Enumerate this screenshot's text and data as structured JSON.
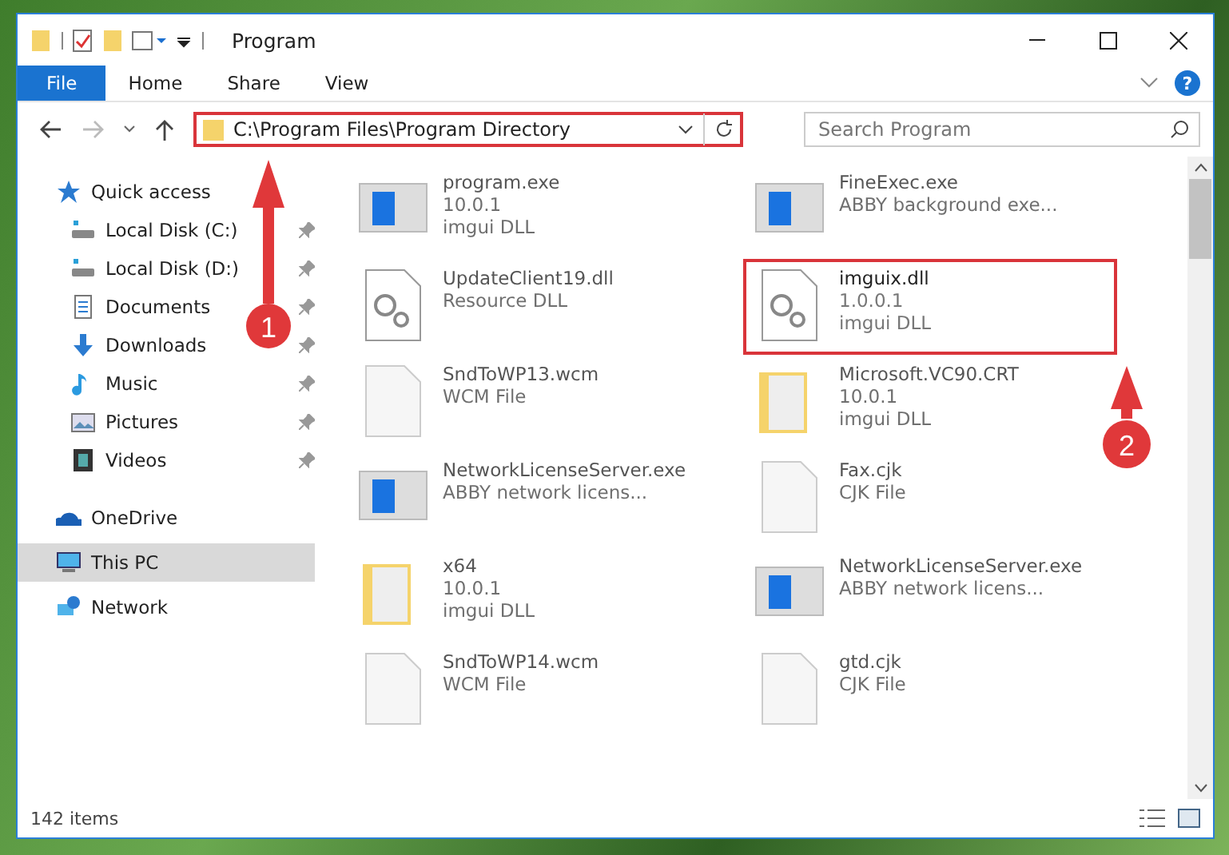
{
  "window": {
    "title": "Program"
  },
  "ribbon_tabs": [
    {
      "label": "File",
      "selected": true
    },
    {
      "label": "Home",
      "selected": false
    },
    {
      "label": "Share",
      "selected": false
    },
    {
      "label": "View",
      "selected": false
    }
  ],
  "help": "?",
  "address": {
    "path": "C:\\Program Files\\Program Directory"
  },
  "search": {
    "placeholder": "Search Program"
  },
  "sidebar": {
    "items": [
      {
        "label": "Quick access",
        "selected": false,
        "children": [
          {
            "label": "Local Disk (C:)",
            "pinned": true,
            "selected": false
          },
          {
            "label": "Local Disk (D:)",
            "pinned": true,
            "selected": false
          },
          {
            "label": "Documents",
            "pinned": true,
            "selected": false
          },
          {
            "label": "Downloads",
            "pinned": true,
            "selected": false
          },
          {
            "label": "Music",
            "pinned": true,
            "selected": false
          },
          {
            "label": "Pictures",
            "pinned": true,
            "selected": false
          },
          {
            "label": "Videos",
            "pinned": true,
            "selected": false
          }
        ]
      },
      {
        "label": "OneDrive",
        "selected": false
      },
      {
        "label": "This PC",
        "selected": true
      },
      {
        "label": "Network",
        "selected": false
      }
    ]
  },
  "files": [
    {
      "kind": "app",
      "lines": [
        "program.exe",
        "10.0.1",
        "imgui DLL"
      ],
      "selected": false
    },
    {
      "kind": "app",
      "lines": [
        "FineExec.exe",
        "ABBY background exe..."
      ],
      "selected": false
    },
    {
      "kind": "dll",
      "lines": [
        "UpdateClient19.dll",
        "Resource DLL"
      ],
      "selected": false
    },
    {
      "kind": "dll",
      "lines": [
        "imguix.dll",
        "1.0.0.1",
        "imgui DLL"
      ],
      "selected": true
    },
    {
      "kind": "file",
      "lines": [
        "SndToWP13.wcm",
        "WCM File"
      ],
      "selected": false
    },
    {
      "kind": "folder",
      "lines": [
        "Microsoft.VC90.CRT",
        "10.0.1",
        "imgui DLL"
      ],
      "selected": false
    },
    {
      "kind": "app",
      "lines": [
        "NetworkLicenseServer.exe",
        "ABBY network licens..."
      ],
      "selected": false
    },
    {
      "kind": "file",
      "lines": [
        "Fax.cjk",
        "CJK File"
      ],
      "selected": false
    },
    {
      "kind": "folder",
      "lines": [
        "x64",
        "10.0.1",
        "imgui DLL"
      ],
      "selected": false
    },
    {
      "kind": "app",
      "lines": [
        "NetworkLicenseServer.exe",
        "ABBY network licens..."
      ],
      "selected": false
    },
    {
      "kind": "file",
      "lines": [
        "SndToWP14.wcm",
        "WCM File"
      ],
      "selected": false
    },
    {
      "kind": "file",
      "lines": [
        "gtd.cjk",
        "CJK File"
      ],
      "selected": false
    }
  ],
  "status_bar": {
    "count": "142 items"
  },
  "annotations": [
    {
      "number": "1"
    },
    {
      "number": "2"
    }
  ]
}
